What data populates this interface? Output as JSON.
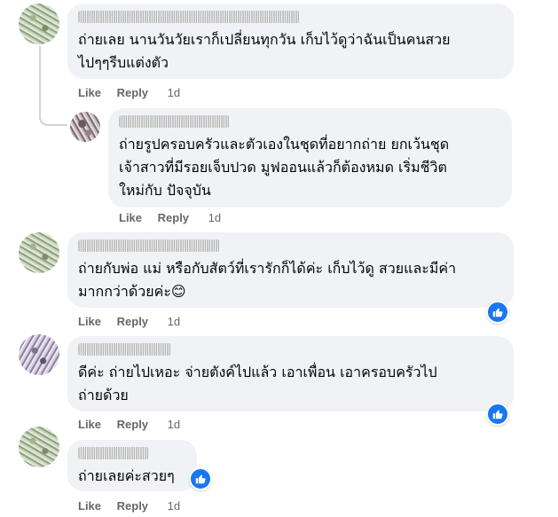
{
  "comments": [
    {
      "text": "ถ่ายเลย นานวันวัยเราก็เปลี่ยนทุกวัน เก็บไว้ดูว่าฉันเป็นคนสวย\nไปๆๆรีบแต่งตัว",
      "like": "Like",
      "reply": "Reply",
      "time": "1d",
      "has_reaction": false
    },
    {
      "text": "ถ่ายรูปครอบครัวและตัวเองในชุดที่อยากถ่าย ยกเว้นชุด\nเจ้าสาวที่มีรอยเจ็บปวด มูฟออนแล้วก็ต้องหมด เริ่มชีวิต\nใหม่กับ ปัจจุบัน",
      "like": "Like",
      "reply": "Reply",
      "time": "1d",
      "has_reaction": false
    },
    {
      "text": "ถ่ายกับพ่อ แม่ หรือกับสัตว์ที่เรารักก็ได้ค่ะ เก็บไว้ดู สวยและมีค่า\nมากกว่าด้วยค่ะ😊",
      "like": "Like",
      "reply": "Reply",
      "time": "1d",
      "has_reaction": true
    },
    {
      "text": "ดีค่ะ ถ่ายไปเหอะ จ่ายตังค์ไปแล้ว เอาเพื่อน เอาครอบครัวไป\nถ่ายด้วย",
      "like": "Like",
      "reply": "Reply",
      "time": "1d",
      "has_reaction": true
    },
    {
      "text": "ถ่ายเลยค่ะสวยๆ",
      "like": "Like",
      "reply": "Reply",
      "time": "1d",
      "has_reaction": true
    }
  ],
  "icons": {
    "reaction": "like-thumb-icon"
  },
  "colors": {
    "bubble": "#f0f2f5",
    "reaction": "#1877f2",
    "meta": "#65676b"
  }
}
